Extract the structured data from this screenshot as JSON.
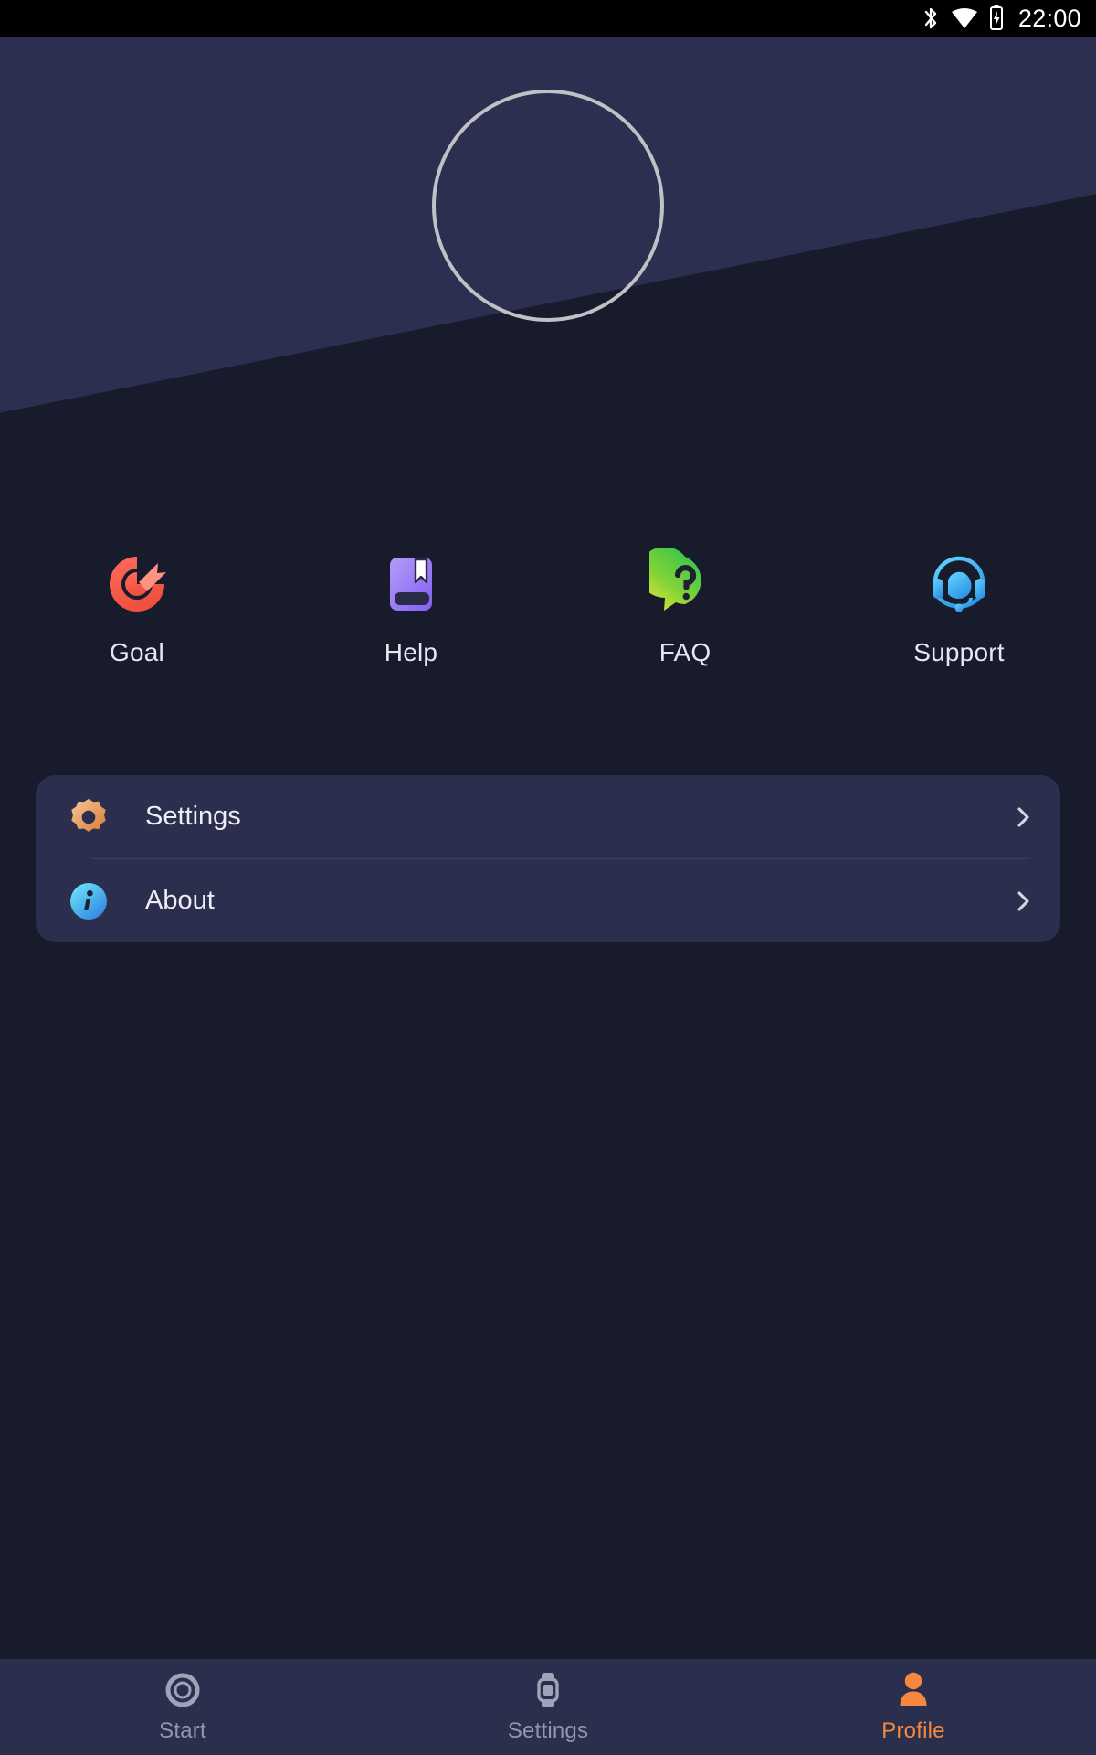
{
  "statusbar": {
    "time": "22:00",
    "icons": [
      {
        "name": "bluetooth-icon",
        "label": "Bluetooth"
      },
      {
        "name": "wifi-icon",
        "label": "Wi-Fi"
      },
      {
        "name": "battery-charging-icon",
        "label": "Battery charging"
      }
    ]
  },
  "header": {
    "avatar_name": "profile-avatar-placeholder",
    "avatar_label": "",
    "background_color": "#2C2F50",
    "page_background": "#181B2C"
  },
  "quick_actions": [
    {
      "label": "Goal",
      "icon": "target-goal-icon",
      "color": "#F4634C"
    },
    {
      "label": "Help",
      "icon": "book-bookmark-icon",
      "color": "#9B7BF5"
    },
    {
      "label": "FAQ",
      "icon": "question-bubble-icon",
      "color": "#8FD33A"
    },
    {
      "label": "Support",
      "icon": "headset-agent-icon",
      "color": "#39A5E8"
    }
  ],
  "menu": {
    "card_color": "#2B2E4C",
    "items": [
      {
        "label": "Settings",
        "icon": "gear-icon",
        "icon_color": "#E9A263",
        "chevron": "chevron-right-icon"
      },
      {
        "label": "About",
        "icon": "info-circle-icon",
        "icon_color": "#3FC4F0",
        "chevron": "chevron-right-icon"
      }
    ]
  },
  "bottom_nav": {
    "active_color": "#F5883E",
    "inactive_color": "#9195AE",
    "items": [
      {
        "label": "Start",
        "icon": "ring-start-icon",
        "active": false
      },
      {
        "label": "Settings",
        "icon": "smartwatch-icon",
        "active": false
      },
      {
        "label": "Profile",
        "icon": "person-icon",
        "active": true
      }
    ]
  }
}
